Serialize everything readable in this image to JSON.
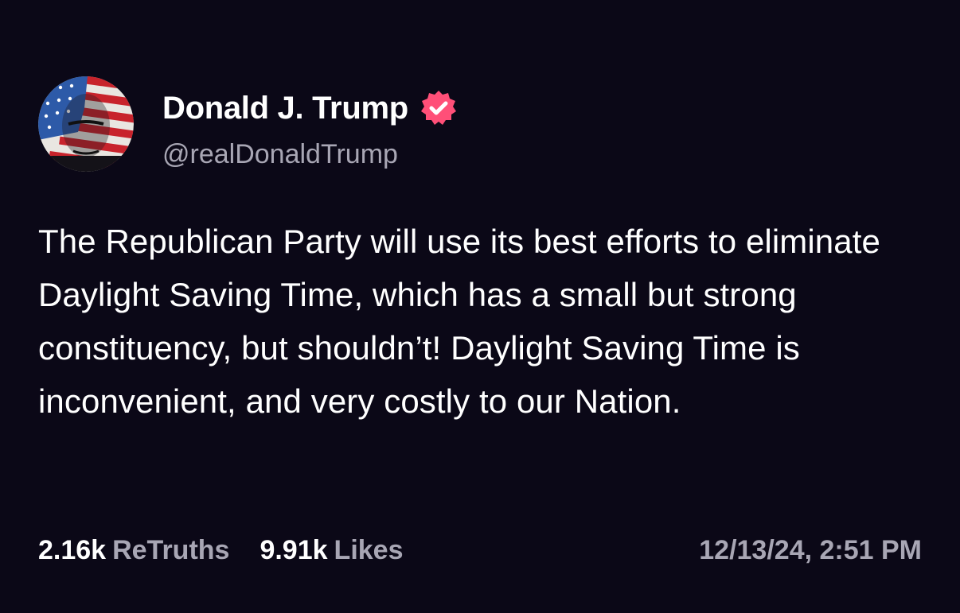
{
  "author": {
    "display_name": "Donald J. Trump",
    "handle": "@realDonaldTrump",
    "avatar_icon": "flag-portrait-avatar",
    "verified_icon": "verified-badge-icon",
    "verified_color": "#ff4f78"
  },
  "post": {
    "text": "The Republican Party will use its best efforts to eliminate Daylight Saving Time, which has a small but strong constituency, but shouldn’t! Daylight Saving Time is inconvenient, and very costly to our Nation."
  },
  "stats": {
    "retruths_count": "2.16k",
    "retruths_label": "ReTruths",
    "likes_count": "9.91k",
    "likes_label": "Likes"
  },
  "timestamp": "12/13/24, 2:51 PM",
  "colors": {
    "background": "#0b0817",
    "text": "#ffffff",
    "muted": "#a8a6b4",
    "accent": "#ff4f78"
  }
}
